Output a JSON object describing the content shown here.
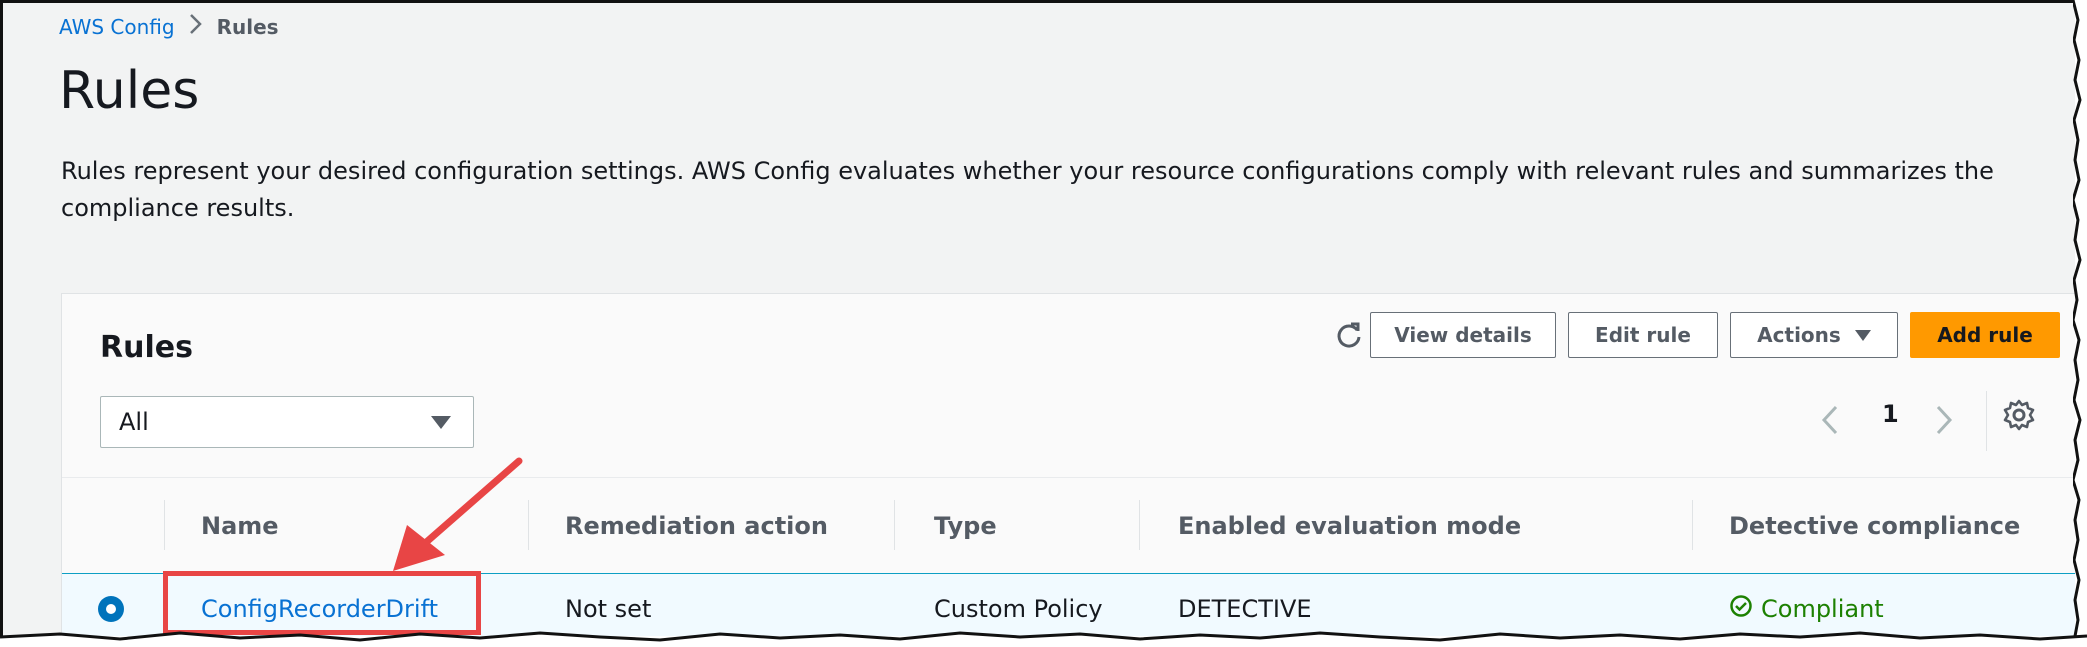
{
  "breadcrumb": {
    "parent": "AWS Config",
    "separator": ">",
    "current": "Rules"
  },
  "page": {
    "title": "Rules",
    "description": "Rules represent your desired configuration settings. AWS Config evaluates whether your resource configurations comply with relevant rules and summarizes the compliance results."
  },
  "panel": {
    "title": "Rules",
    "toolbar": {
      "refresh_icon": "refresh-icon",
      "view_details": "View details",
      "edit_rule": "Edit rule",
      "actions": "Actions",
      "add_rule": "Add rule"
    },
    "filter": {
      "selected": "All"
    },
    "pagination": {
      "current_page": "1"
    },
    "table": {
      "columns": [
        "Name",
        "Remediation action",
        "Type",
        "Enabled evaluation mode",
        "Detective compliance"
      ],
      "rows": [
        {
          "selected": true,
          "name": "ConfigRecorderDrift",
          "remediation_action": "Not set",
          "type": "Custom Policy",
          "evaluation_mode": "DETECTIVE",
          "detective_compliance": "Compliant"
        }
      ]
    }
  },
  "colors": {
    "link": "#0972d3",
    "primary_button": "#ff9900",
    "compliant": "#1d8102",
    "annotation": "#e84545",
    "selected_row": "#f1faff"
  }
}
